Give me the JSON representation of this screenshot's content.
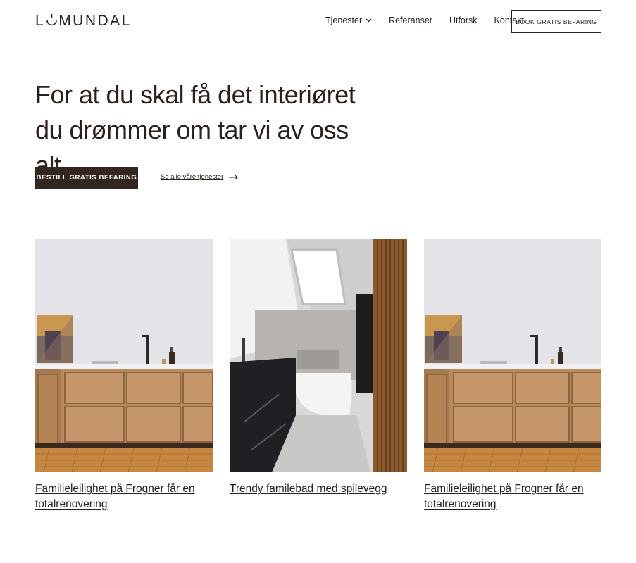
{
  "header": {
    "logo_text": {
      "before": "L",
      "after": "MUNDAL"
    },
    "nav": [
      {
        "label": "Tjenester",
        "has_dropdown": true
      },
      {
        "label": "Referanser"
      },
      {
        "label": "Utforsk"
      },
      {
        "label": "Kontakt"
      }
    ],
    "cta_label": "BOOK GRATIS BEFARING"
  },
  "hero": {
    "heading": "For at du skal få det interiøret du drømmer om tar vi av oss alt",
    "primary_button": "BESTILL GRATIS BEFARING",
    "secondary_link": "Se alle våre tjenester"
  },
  "projects": [
    {
      "title": "Familieleilighet på Frogner får en totalrenovering",
      "image": "kitchen-oak-cabinets"
    },
    {
      "title": "Trendy familebad med spilevegg",
      "image": "bathroom-skylight"
    },
    {
      "title": "Familieleilighet på Frogner får en totalrenovering",
      "image": "kitchen-oak-cabinets"
    }
  ],
  "colors": {
    "text": "#2a211d",
    "primary_button": "#33251f",
    "background": "#ffffff"
  }
}
